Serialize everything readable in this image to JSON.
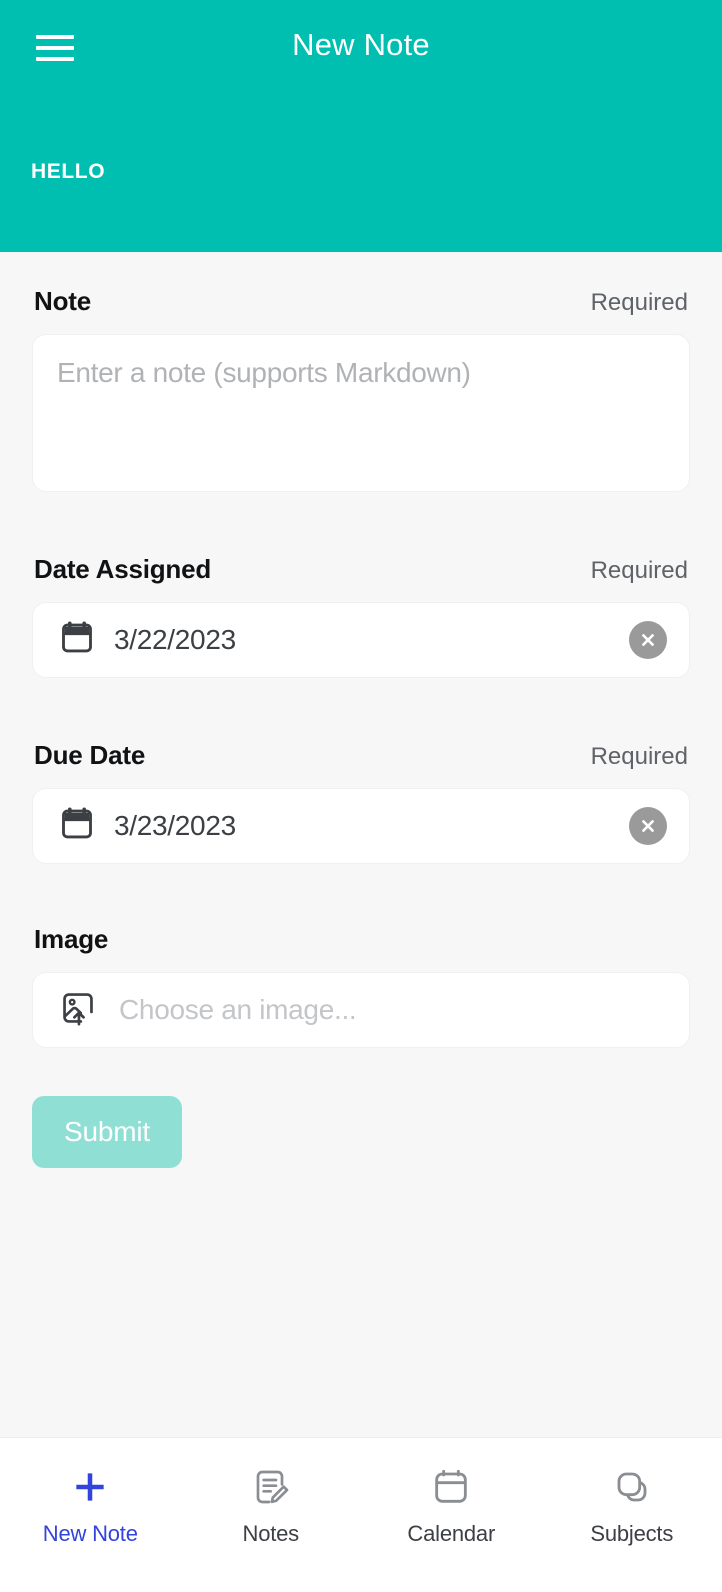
{
  "header": {
    "title": "New Note",
    "greeting": "HELLO",
    "menu_icon": "hamburger-menu-icon",
    "background_color": "#00bfb0"
  },
  "form": {
    "note": {
      "label": "Note",
      "required_text": "Required",
      "placeholder": "Enter a note (supports Markdown)",
      "value": ""
    },
    "date_assigned": {
      "label": "Date Assigned",
      "required_text": "Required",
      "value": "3/22/2023",
      "icon": "calendar-icon",
      "clear_icon": "close-circle-icon"
    },
    "due_date": {
      "label": "Due Date",
      "required_text": "Required",
      "value": "3/23/2023",
      "icon": "calendar-icon",
      "clear_icon": "close-circle-icon"
    },
    "image": {
      "label": "Image",
      "placeholder": "Choose an image...",
      "value": "",
      "icon": "image-upload-icon"
    },
    "submit": {
      "label": "Submit",
      "disabled": true,
      "color": "#8fdfd4"
    }
  },
  "bottom_nav": {
    "active_color": "#3344dd",
    "inactive_color": "#8a8d91",
    "items": [
      {
        "label": "New Note",
        "icon": "plus-icon",
        "active": true
      },
      {
        "label": "Notes",
        "icon": "note-pencil-icon",
        "active": false
      },
      {
        "label": "Calendar",
        "icon": "calendar-icon",
        "active": false
      },
      {
        "label": "Subjects",
        "icon": "stacked-squares-icon",
        "active": false
      }
    ]
  }
}
